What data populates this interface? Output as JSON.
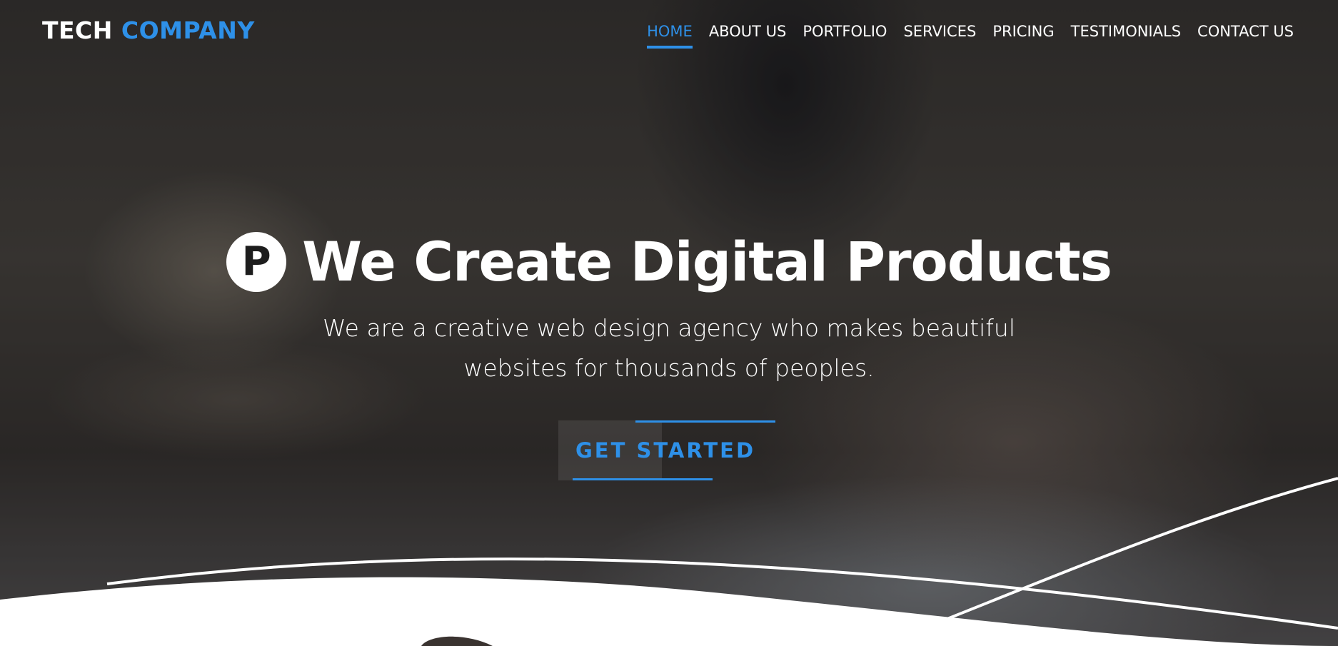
{
  "brand": {
    "name_primary": "TECH",
    "name_accent": "COMPANY",
    "accent_color": "#2e90e8"
  },
  "nav": {
    "items": [
      {
        "label": "HOME",
        "active": true
      },
      {
        "label": "ABOUT US",
        "active": false
      },
      {
        "label": "PORTFOLIO",
        "active": false
      },
      {
        "label": "SERVICES",
        "active": false
      },
      {
        "label": "PRICING",
        "active": false
      },
      {
        "label": "TESTIMONIALS",
        "active": false
      },
      {
        "label": "CONTACT US",
        "active": false
      }
    ]
  },
  "hero": {
    "badge_letter": "P",
    "badge_icon": "p-circle-icon",
    "headline": "We Create Digital Products",
    "subtext_line1": "We are a creative web design agency who makes beautiful",
    "subtext_line2": "websites for thousands of peoples.",
    "cta_label": "GET STARTED"
  }
}
